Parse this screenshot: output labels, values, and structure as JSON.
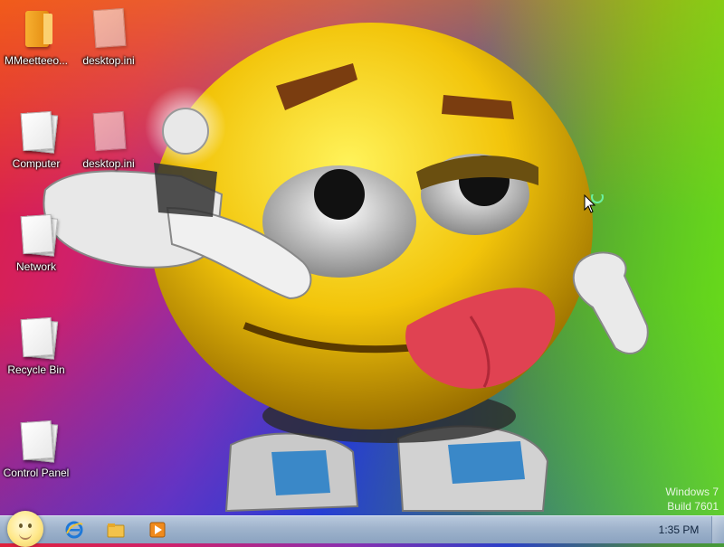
{
  "desktop": {
    "icons": [
      {
        "label": "MMeetteeo...",
        "icon": "folder-icon"
      },
      {
        "label": "desktop.ini",
        "icon": "document-icon"
      },
      {
        "label": "Computer",
        "icon": "document-icon"
      },
      {
        "label": "desktop.ini",
        "icon": "document-icon"
      },
      {
        "label": "Network",
        "icon": "document-icon"
      },
      {
        "label": "Recycle Bin",
        "icon": "document-icon"
      },
      {
        "label": "Control Panel",
        "icon": "document-icon"
      }
    ],
    "wallpaper": "smiley-emoticon-wallpaper"
  },
  "watermark": {
    "line1": "Windows 7",
    "line2": "Build 7601"
  },
  "taskbar": {
    "start": "start-orb-icon",
    "pinned": [
      {
        "name": "internet-explorer-icon",
        "color": "#1e78d8"
      },
      {
        "name": "windows-explorer-icon",
        "color": "#f3c24a"
      },
      {
        "name": "media-player-icon",
        "color": "#f08a1c"
      }
    ],
    "clock": "1:35 PM"
  }
}
